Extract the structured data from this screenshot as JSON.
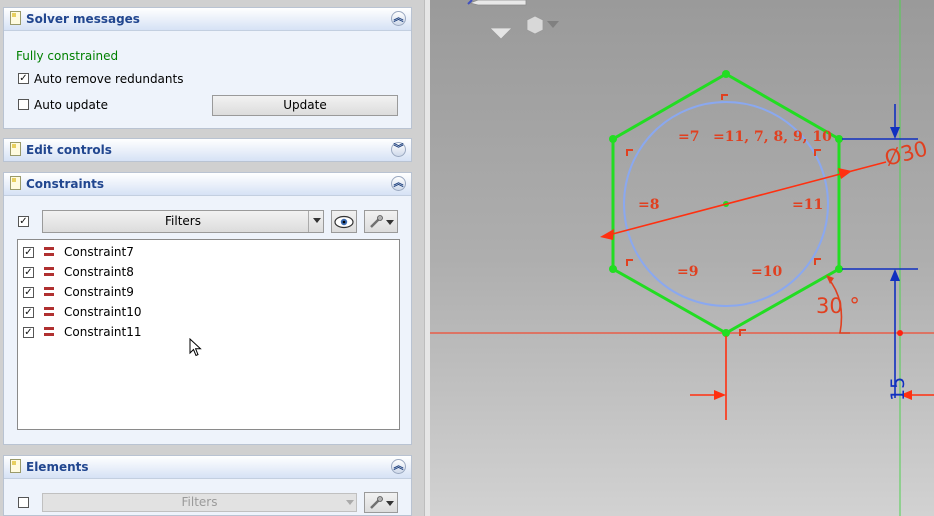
{
  "solver_panel": {
    "title": "Solver messages",
    "status": "Fully constrained",
    "status_color": "#008000",
    "auto_remove_label": "Auto remove redundants",
    "auto_remove_checked": true,
    "auto_update_label": "Auto update",
    "auto_update_checked": false,
    "update_button": "Update"
  },
  "edit_controls_panel": {
    "title": "Edit controls"
  },
  "constraints_panel": {
    "title": "Constraints",
    "filter_checked": true,
    "filters_label": "Filters",
    "items": [
      {
        "label": "Constraint7",
        "checked": true
      },
      {
        "label": "Constraint8",
        "checked": true
      },
      {
        "label": "Constraint9",
        "checked": true
      },
      {
        "label": "Constraint10",
        "checked": true
      },
      {
        "label": "Constraint11",
        "checked": true
      }
    ]
  },
  "elements_panel": {
    "title": "Elements",
    "filter_checked": false,
    "filters_label": "Filters"
  },
  "sketch_labels": {
    "eq_top_left": "=7",
    "eq_top_group": "=11, 7, 8, 9, 10",
    "eq_left": "=8",
    "eq_right": "=11",
    "eq_bottom_left": "=9",
    "eq_bottom_right": "=10",
    "diameter": "Ø30",
    "angle": "30 °",
    "distance": "15"
  },
  "colors": {
    "hexagon": "#22dd22",
    "constraint": "#e04020",
    "circle": "#8aa8f0",
    "dimension_blue": "#1030c0",
    "axis_red": "#ff3010",
    "axis_green": "#50d050"
  }
}
